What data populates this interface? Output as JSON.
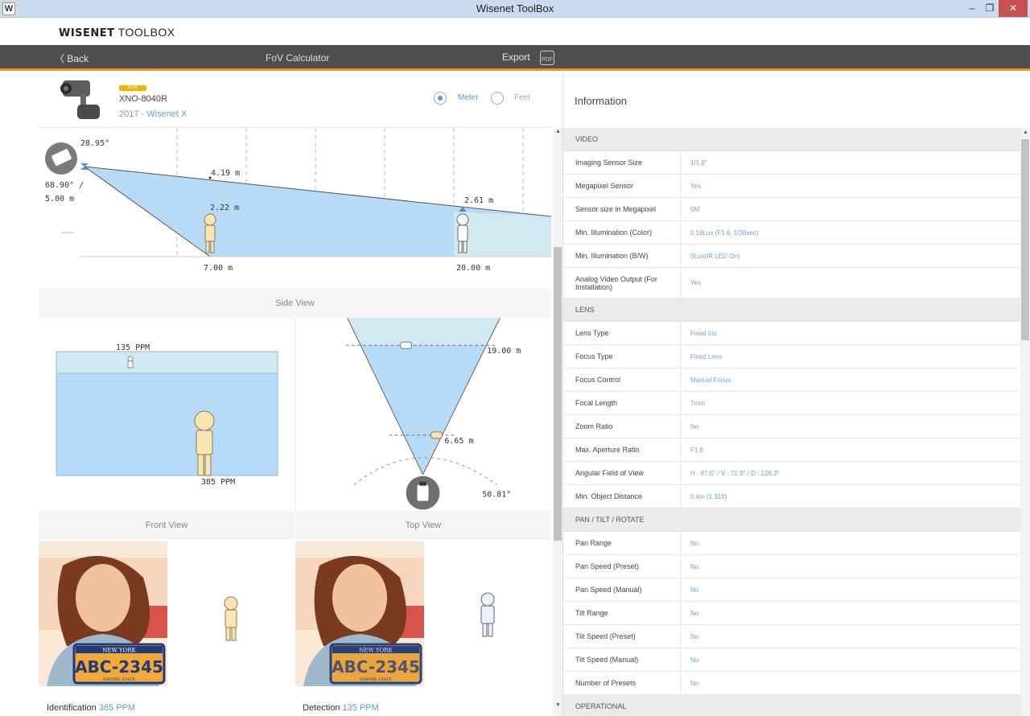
{
  "window": {
    "title": "Wisenet ToolBox",
    "icon_letter": "W",
    "min": "–",
    "max": "❐",
    "close": "✕"
  },
  "brand": {
    "logo_bold": "WISENET",
    "logo_rest": " TOOLBOX"
  },
  "nav": {
    "back": "Back",
    "title": "FoV Calculator",
    "export": "Export",
    "export_icon_text": "PDF"
  },
  "camera": {
    "badge": "HDR",
    "model": "XNO-8040R",
    "series": "2017 - Wisenet X",
    "unit_meter": "Meter",
    "unit_feet": "Feet",
    "selected_unit": "Meter"
  },
  "side_view": {
    "tilt_angle": "28.95°",
    "fov": "68.90° /",
    "height": "5.00 m",
    "dist_top_near": "4.19 m",
    "dist_near": "2.22 m",
    "dist_far": "2.61 m",
    "ground_near": "7.00 m",
    "ground_far": "20.00 m",
    "label": "Side View"
  },
  "front_view": {
    "ppm_far": "135 PPM",
    "ppm_near": "385 PPM",
    "label": "Front View"
  },
  "top_view": {
    "far": "19.00 m",
    "near": "6.65 m",
    "angle": "50.81°",
    "label": "Top View"
  },
  "samples": [
    {
      "plate_top": "NEW YORK",
      "plate": "ABC-2345",
      "plate_bottom": "EMPIRE STATE",
      "caption": "Identification",
      "ppm": "385 PPM"
    },
    {
      "plate_top": "NEW YORK",
      "plate": "ABC-2345",
      "plate_bottom": "EMPIRE STATE",
      "caption": "Detection",
      "ppm": "135 PPM"
    }
  ],
  "info": {
    "title": "Information",
    "sections": [
      {
        "name": "VIDEO",
        "rows": [
          {
            "k": "Imaging Sensor Size",
            "v": "1/1.8\""
          },
          {
            "k": "Megapixel Sensor",
            "v": "Yes"
          },
          {
            "k": "Sensor size in Megapixel",
            "v": "5M"
          },
          {
            "k": "Min. Illumination (Color)",
            "v": "0.16Lux (F1.6, 1/30sec)"
          },
          {
            "k": "Min. Illumination (B/W)",
            "v": "0Lux(IR LED On)"
          },
          {
            "k": "Analog Video Output (For Installation)",
            "v": "Yes"
          }
        ]
      },
      {
        "name": "LENS",
        "rows": [
          {
            "k": "Lens Type",
            "v": "Fixed Iris"
          },
          {
            "k": "Focus Type",
            "v": "Fixed Lens"
          },
          {
            "k": "Focus Control",
            "v": "Manual Focus"
          },
          {
            "k": "Focal Length",
            "v": "7mm"
          },
          {
            "k": "Zoom Ratio",
            "v": "No"
          },
          {
            "k": "Max. Aperture Ratio",
            "v": "F1.6"
          },
          {
            "k": "Angular Field of View",
            "v": "H : 97.5° / V : 71.9° / D : 126.2°"
          },
          {
            "k": "Min. Object Distance",
            "v": "0.4m (1.31ft)"
          }
        ]
      },
      {
        "name": "PAN / TILT / ROTATE",
        "rows": [
          {
            "k": "Pan Range",
            "v": "No"
          },
          {
            "k": "Pan Speed (Preset)",
            "v": "No"
          },
          {
            "k": "Pan Speed (Manual)",
            "v": "No"
          },
          {
            "k": "Tilt Range",
            "v": "No"
          },
          {
            "k": "Tilt Speed (Preset)",
            "v": "No"
          },
          {
            "k": "Tilt Speed (Manual)",
            "v": "No"
          },
          {
            "k": "Number of Presets",
            "v": "No"
          }
        ]
      },
      {
        "name": "OPERATIONAL",
        "rows": []
      }
    ]
  },
  "colors": {
    "accent": "#f08c1e",
    "fov_blue": "#b7dbf6",
    "link_blue": "#5a9bd3",
    "navbar": "#4f4f4f"
  }
}
